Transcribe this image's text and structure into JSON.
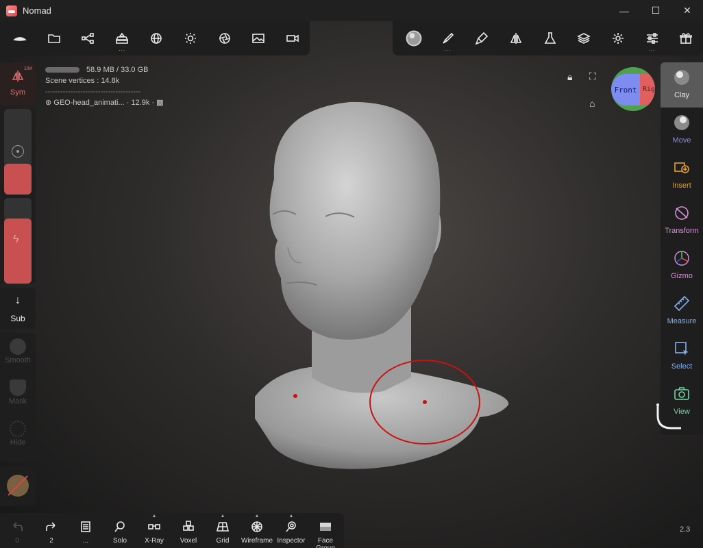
{
  "window": {
    "title": "Nomad",
    "minimize": "—",
    "maximize": "☐",
    "close": "✕"
  },
  "info": {
    "memory": "58.9 MB / 33.0 GB",
    "scene_vertices": "Scene vertices : 14.8k",
    "separator": "--------------------------------------",
    "object_name": "GEO-head_animati...",
    "object_vertices": "· 12.9k ·"
  },
  "left_panel": {
    "sym_label": "Sym",
    "sym_badge": "1/M",
    "sub_label": "Sub",
    "tools": [
      "Smooth",
      "Mask",
      "Hide"
    ]
  },
  "orientation_cube": {
    "front": "Front",
    "right": "Rig"
  },
  "right_tools": [
    {
      "label": "Clay",
      "color": "#e8e8e8"
    },
    {
      "label": "Move",
      "color": "#8a8ad8"
    },
    {
      "label": "Insert",
      "color": "#e8a030"
    },
    {
      "label": "Transform",
      "color": "#d890d8"
    },
    {
      "label": "Gizmo",
      "color": "#d890d8"
    },
    {
      "label": "Measure",
      "color": "#80b0f0"
    },
    {
      "label": "Select",
      "color": "#80b0f0"
    },
    {
      "label": "View",
      "color": "#70d8a8"
    }
  ],
  "bottom_toolbar": {
    "undo_count": "0",
    "redo_count": "2",
    "history_label": "...",
    "items": [
      "Solo",
      "X-Ray",
      "Voxel",
      "Grid",
      "Wireframe",
      "Inspector",
      "Face Group"
    ]
  },
  "version": "2.3",
  "colors": {
    "accent_red": "#c85050",
    "stroke_red": "#cc1111"
  }
}
